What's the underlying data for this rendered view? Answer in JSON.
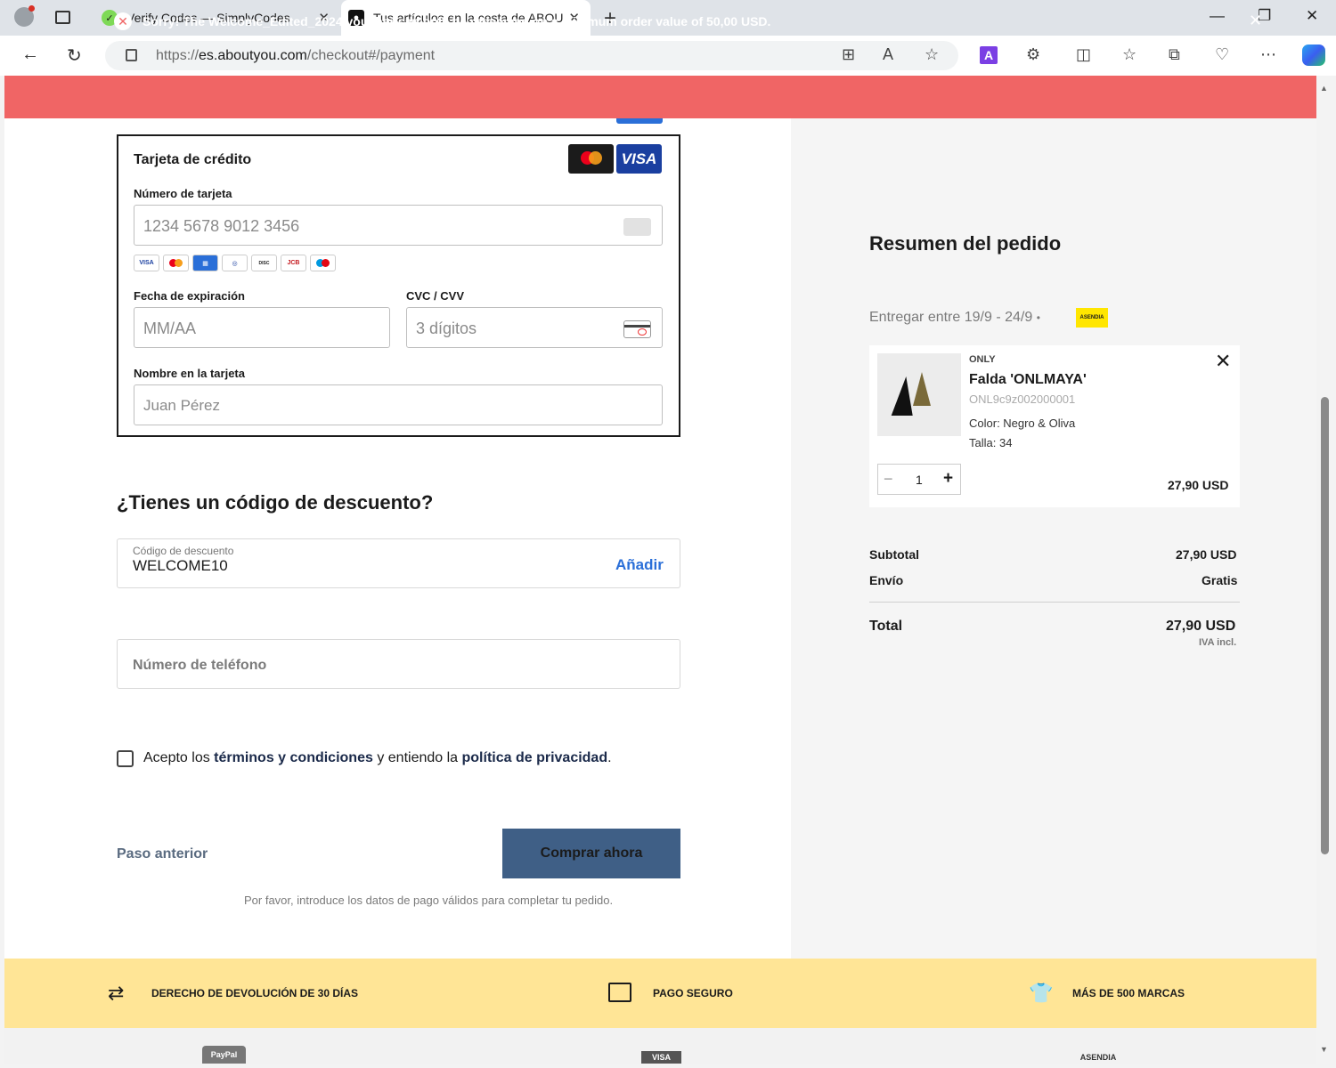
{
  "browser": {
    "tabs": [
      {
        "title": "Verify Codes — SimplyCodes",
        "close": "✕"
      },
      {
        "title": "Tus artículos en la cesta de ABOU",
        "close": "✕"
      }
    ],
    "new_tab": "+",
    "url_prefix": "https://",
    "url_host": "es.aboutyou.com",
    "url_path": "/checkout#/payment"
  },
  "alert": {
    "message": "Sorry! The Welcome_Edited_2024 voucher can only be redeemed on a minimum order value of 50,00 USD.",
    "icon": "✕",
    "close": "✕",
    "color": "#f06565"
  },
  "payment": {
    "title": "Tarjeta de crédito",
    "visa_logo": "VISA",
    "card_number_label": "Número de tarjeta",
    "card_number_placeholder": "1234 5678 9012 3456",
    "expiry_label": "Fecha de expiración",
    "expiry_placeholder": "MM/AA",
    "cvc_label": "CVC / CVV",
    "cvc_placeholder": "3 dígitos",
    "name_label": "Nombre en la tarjeta",
    "name_placeholder": "Juan Pérez",
    "mini_brands": [
      "VISA",
      "MC",
      "AMEX",
      "DINERS",
      "DISCOVER",
      "JCB",
      "MAESTRO"
    ]
  },
  "discount": {
    "title": "¿Tienes un código de descuento?",
    "label": "Código de descuento",
    "value": "WELCOME10",
    "add": "Añadir"
  },
  "phone": {
    "placeholder": "Número de teléfono"
  },
  "terms": {
    "prefix": "Acepto los ",
    "terms_link": "términos y condiciones",
    "middle": " y entiendo la ",
    "privacy_link": "política de privacidad",
    "suffix": "."
  },
  "actions": {
    "back": "Paso anterior",
    "buy": "Comprar ahora",
    "note": "Por favor, introduce los datos de pago válidos para completar tu pedido."
  },
  "summary": {
    "title": "Resumen del pedido",
    "delivery": "Entregar entre 19/9 - 24/9",
    "carrier_logo": "ASENDIA",
    "item": {
      "brand": "ONLY",
      "name": "Falda 'ONLMAYA'",
      "sku": "ONL9c9z002000001",
      "color": "Color: Negro & Oliva",
      "size": "Talla: 34",
      "quantity": "1",
      "price": "27,90 USD"
    },
    "subtotal_label": "Subtotal",
    "subtotal_value": "27,90 USD",
    "shipping_label": "Envío",
    "shipping_value": "Gratis",
    "total_label": "Total",
    "total_value": "27,90 USD",
    "vat_note": "IVA incl."
  },
  "benefits": [
    {
      "icon": "returns-arrows-icon",
      "text": "DERECHO DE DEVOLUCIÓN DE 30 DÍAS"
    },
    {
      "icon": "secure-payment-icon",
      "text": "PAGO SEGURO"
    },
    {
      "icon": "shirt-icon",
      "text": "MÁS DE 500 MARCAS"
    }
  ],
  "footer_logos": [
    "PayPal",
    "VISA",
    "ASENDIA"
  ]
}
